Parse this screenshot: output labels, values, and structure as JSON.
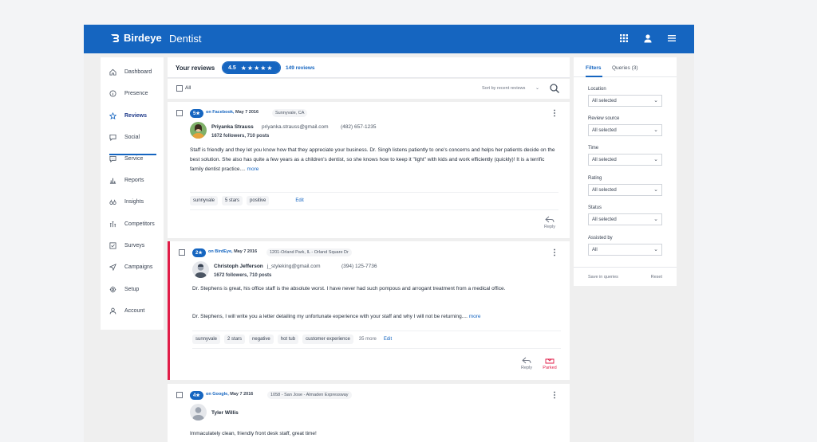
{
  "app": {
    "brand": "Birdeye",
    "title": "Dentist"
  },
  "sidebar": {
    "items": [
      {
        "label": "Dashboard",
        "icon": "home-icon"
      },
      {
        "label": "Presence",
        "icon": "info-icon"
      },
      {
        "label": "Reviews",
        "icon": "star-icon",
        "active": true
      },
      {
        "label": "Social",
        "icon": "chat-icon"
      },
      {
        "label": "Service",
        "icon": "message-icon"
      },
      {
        "label": "Reports",
        "icon": "bar-chart-icon"
      },
      {
        "label": "Insights",
        "icon": "binoculars-icon"
      },
      {
        "label": "Competitors",
        "icon": "compare-icon"
      },
      {
        "label": "Surveys",
        "icon": "checklist-icon"
      },
      {
        "label": "Campaigns",
        "icon": "send-icon"
      },
      {
        "label": "Setup",
        "icon": "gear-icon"
      },
      {
        "label": "Account",
        "icon": "person-icon"
      }
    ]
  },
  "reviews_header": {
    "title": "Your reviews",
    "rating": "4.5",
    "stars": "★★★★★",
    "count": "149 reviews"
  },
  "toolbar": {
    "select_all": "All",
    "sort": "Sort by recent reviews"
  },
  "reviews": [
    {
      "stars": "5★",
      "source": "on Facebook,",
      "date": "May 7 2016",
      "location": "Sunnyvale, CA",
      "name": "Priyanka Strauss",
      "email": "priyanka.strauss@gmail.com",
      "phone": "(482) 657-1235",
      "followers": "1672 followers, 710 posts",
      "text": "Staff is friendly and they let you know how that they appreciate your business.  Dr. Singh listens patiently to one's concerns and  helps her patients decide on the best solution. She also has quite a few years as a children's dentist, so she knows how to keep it \"light\" with kids and work efficiently (quickly)! It is a terrific family dentist practice....",
      "more": "more",
      "tags": [
        "sunnyvale",
        "5 stars",
        "positive"
      ],
      "edit": "Edit",
      "reply": "Reply"
    },
    {
      "stars": "2★",
      "source": "on BirdEye,",
      "date": "May 7 2016",
      "location": "1201-Orland Park, IL - Orland Square Dr",
      "name": "Christoph Jefferson",
      "email": "j_styleking@gmail.com",
      "phone": "(394) 125-7736",
      "followers": "1672 followers, 710 posts",
      "text1": "Dr. Stephens is great, his office staff is the absolute worst. I have never had such pompous and arrogant treatment from a medical office.",
      "text2": "Dr. Stephens, I will write you a letter detailing my unfortunate experience with your staff and why I will not be returning....",
      "more": "more",
      "tags": [
        "sunnyvale",
        "2 stars",
        "negative",
        "hot tub",
        "customer experience"
      ],
      "tag_more": "35 more",
      "edit": "Edit",
      "reply": "Reply",
      "parked": "Parked"
    },
    {
      "stars": "4★",
      "source": "on Google,",
      "date": "May 7 2016",
      "location": "1058 - San Jose - Almaden Expressway",
      "name": "Tyler Willis",
      "text": "Immaculately clean, friendly front desk staff, great time!"
    }
  ],
  "filters": {
    "tabs": [
      "Filters",
      "Queries (3)"
    ],
    "fields": [
      {
        "label": "Location",
        "value": "All selected"
      },
      {
        "label": "Review source",
        "value": "All selected"
      },
      {
        "label": "Time",
        "value": "All selected"
      },
      {
        "label": "Rating",
        "value": "All selected"
      },
      {
        "label": "Status",
        "value": "All selected"
      },
      {
        "label": "Assisted by",
        "value": "All"
      }
    ],
    "save": "Save in queries",
    "reset": "Reset"
  },
  "colors": {
    "brand": "#1565c0",
    "parked": "#e11d48"
  }
}
